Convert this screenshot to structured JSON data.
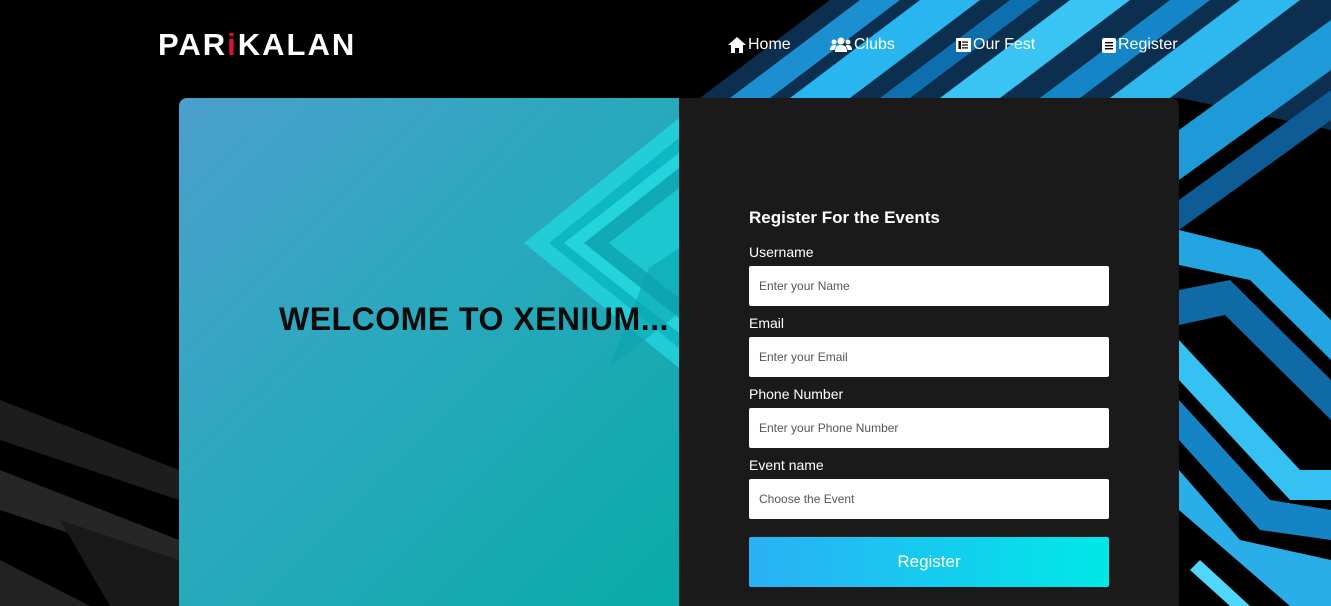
{
  "brand": {
    "prefix": "PAR",
    "accent": "i",
    "suffix": "KALAN"
  },
  "nav": {
    "home": {
      "label": "Home",
      "icon": "home-icon"
    },
    "clubs": {
      "label": "Clubs",
      "icon": "users-icon"
    },
    "fest": {
      "label": "Our Fest",
      "icon": "book-icon"
    },
    "register": {
      "label": "Register",
      "icon": "document-icon"
    }
  },
  "welcome": {
    "heading": "WELCOME TO XENIUM..."
  },
  "form": {
    "title": "Register For the Events",
    "username": {
      "label": "Username",
      "placeholder": "Enter your Name"
    },
    "email": {
      "label": "Email",
      "placeholder": "Enter your Email"
    },
    "phone": {
      "label": "Phone Number",
      "placeholder": "Enter your Phone Number"
    },
    "event": {
      "label": "Event name",
      "placeholder": "Choose the Event"
    },
    "submit_label": "Register"
  },
  "colors": {
    "accent_red": "#e0103a",
    "panel_dark": "#1a1a1a",
    "button_gradient_start": "#2ab0f6",
    "button_gradient_end": "#00e8e8",
    "left_gradient_start": "#4b9fcc",
    "left_gradient_end": "#08aaa8"
  }
}
